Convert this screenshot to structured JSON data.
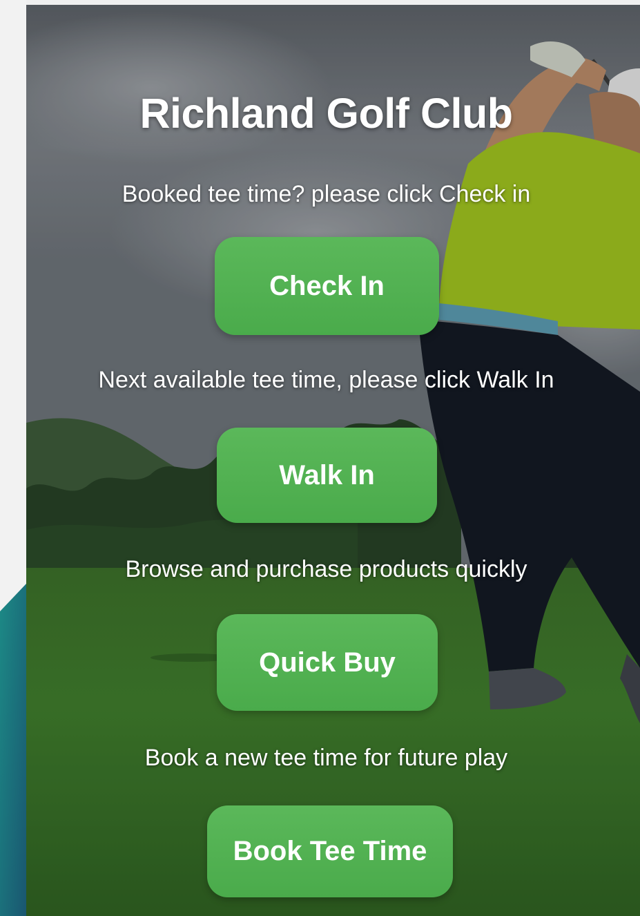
{
  "app": {
    "title": "Richland Golf Club"
  },
  "sections": [
    {
      "prompt": "Booked tee time? please click Check in",
      "button_label": "Check In"
    },
    {
      "prompt": "Next available tee time, please click Walk In",
      "button_label": "Walk In"
    },
    {
      "prompt": "Browse and purchase products quickly",
      "button_label": "Quick Buy"
    },
    {
      "prompt": "Book a new tee time for future play",
      "button_label": "Book Tee Time"
    }
  ],
  "colors": {
    "button": "#52b252",
    "text": "#ffffff",
    "shirt": "#9fc21f",
    "grass": "#3f7a2d",
    "sky": "#6f757b",
    "side_accent": "#1e6f78"
  },
  "background": {
    "image": "golfer-swinging-on-course"
  }
}
